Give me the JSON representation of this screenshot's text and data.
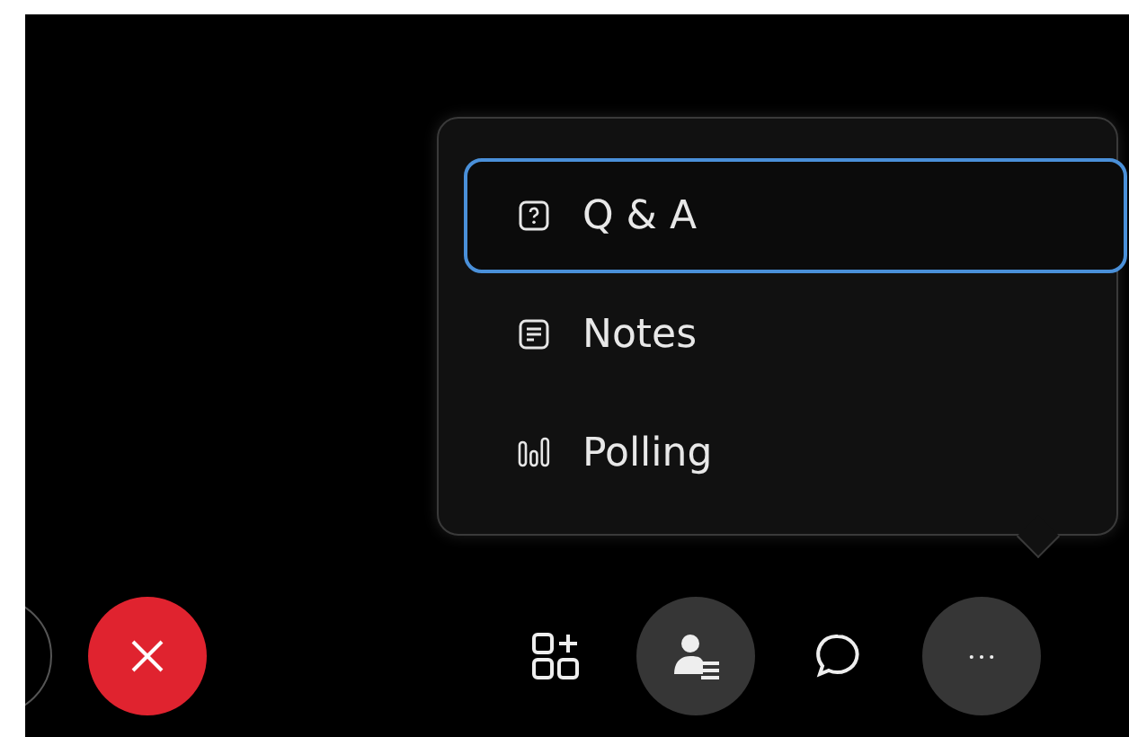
{
  "menu": {
    "items": [
      {
        "label": "Q & A",
        "kind": "question",
        "selected": true
      },
      {
        "label": "Notes",
        "kind": "notes",
        "selected": false
      },
      {
        "label": "Polling",
        "kind": "poll",
        "selected": false
      }
    ]
  },
  "toolbar": {
    "buttons": [
      {
        "kind": "partial"
      },
      {
        "kind": "leave"
      },
      {
        "kind": "apps"
      },
      {
        "kind": "participants"
      },
      {
        "kind": "chat"
      },
      {
        "kind": "more"
      }
    ]
  }
}
